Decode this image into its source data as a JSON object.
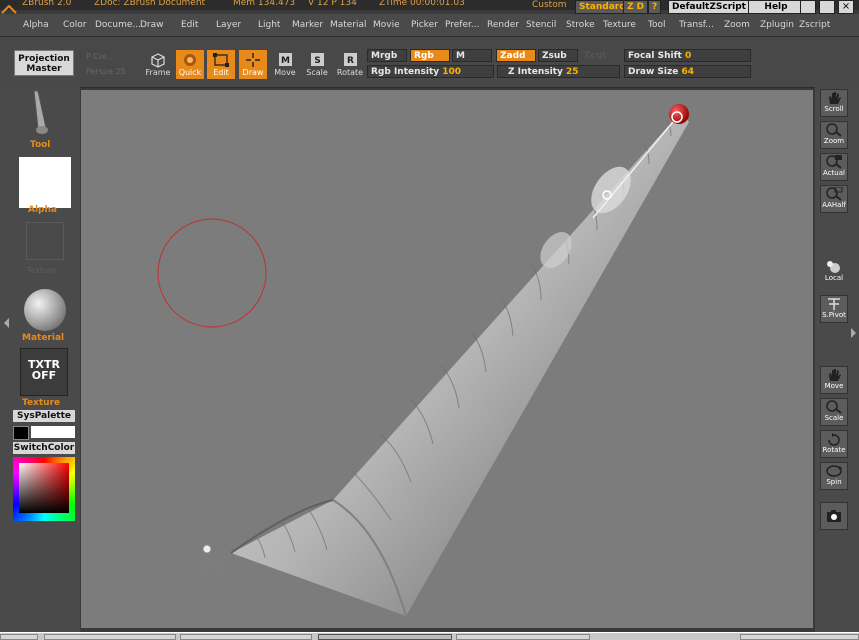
{
  "titlebar": {
    "app": "ZBrush 2.0",
    "doc": "ZDoc: ZBrush Document",
    "mem": "Mem 134.473",
    "poly": "V 12  P 134",
    "ztime": "ZTime 00:00:01.03",
    "custom": "Custom",
    "standard": "Standard",
    "zd": "Z D",
    "help_q": "?",
    "script": "DefaultZScript",
    "help": "Help"
  },
  "menu": [
    "Alpha",
    "Color",
    "Docume...",
    "Draw",
    "Edit",
    "Layer",
    "Light",
    "Marker",
    "Material",
    "Movie",
    "Picker",
    "Prefer...",
    "Render",
    "Stencil",
    "Stroke",
    "Texture",
    "Tool",
    "Transf...",
    "Zoom",
    "Zplugin",
    "Zscript"
  ],
  "shelf": {
    "projection_master": [
      "Projection",
      "Master"
    ],
    "edit_label": "Edit",
    "p_label": "P",
    "pc": "P Cre...",
    "persp": "Perspe 25",
    "frame": "Frame",
    "quick": "Quick",
    "edit": "Edit",
    "draw": "Draw",
    "move": "Move",
    "scale": "Scale",
    "rotate": "Rotate",
    "mrgb": "Mrgb",
    "rgb": "Rgb",
    "m": "M",
    "zadd": "Zadd",
    "zsub": "Zsub",
    "zcut": "Zcut",
    "rgb_intensity_label": "Rgb Intensity",
    "rgb_intensity": "100",
    "z_intensity_label": "Z Intensity",
    "z_intensity": "25",
    "focal_shift_label": "Focal Shift",
    "focal_shift": "0",
    "draw_size_label": "Draw Size",
    "draw_size": "64"
  },
  "left": {
    "tool": "Tool",
    "alpha": "Alpha",
    "stencil_dim": "Texture",
    "material": "Material",
    "txtr": "TXTR",
    "off": "OFF",
    "texture": "Texture",
    "syspalette": "SysPalette",
    "switchcolor": "SwitchColor"
  },
  "right": {
    "scroll": "Scroll",
    "zoom": "Zoom",
    "actual": "Actual",
    "aahalf": "AAHalf",
    "local": "Local",
    "spivot": "S.Pivot",
    "move": "Move",
    "scale": "Scale",
    "rotate": "Rotate",
    "spin": "Spin"
  },
  "colors": {
    "accent": "#e88a1a",
    "value": "#ffb000",
    "canvas": "#7c7c7c",
    "brush_ring": "#c03030"
  }
}
